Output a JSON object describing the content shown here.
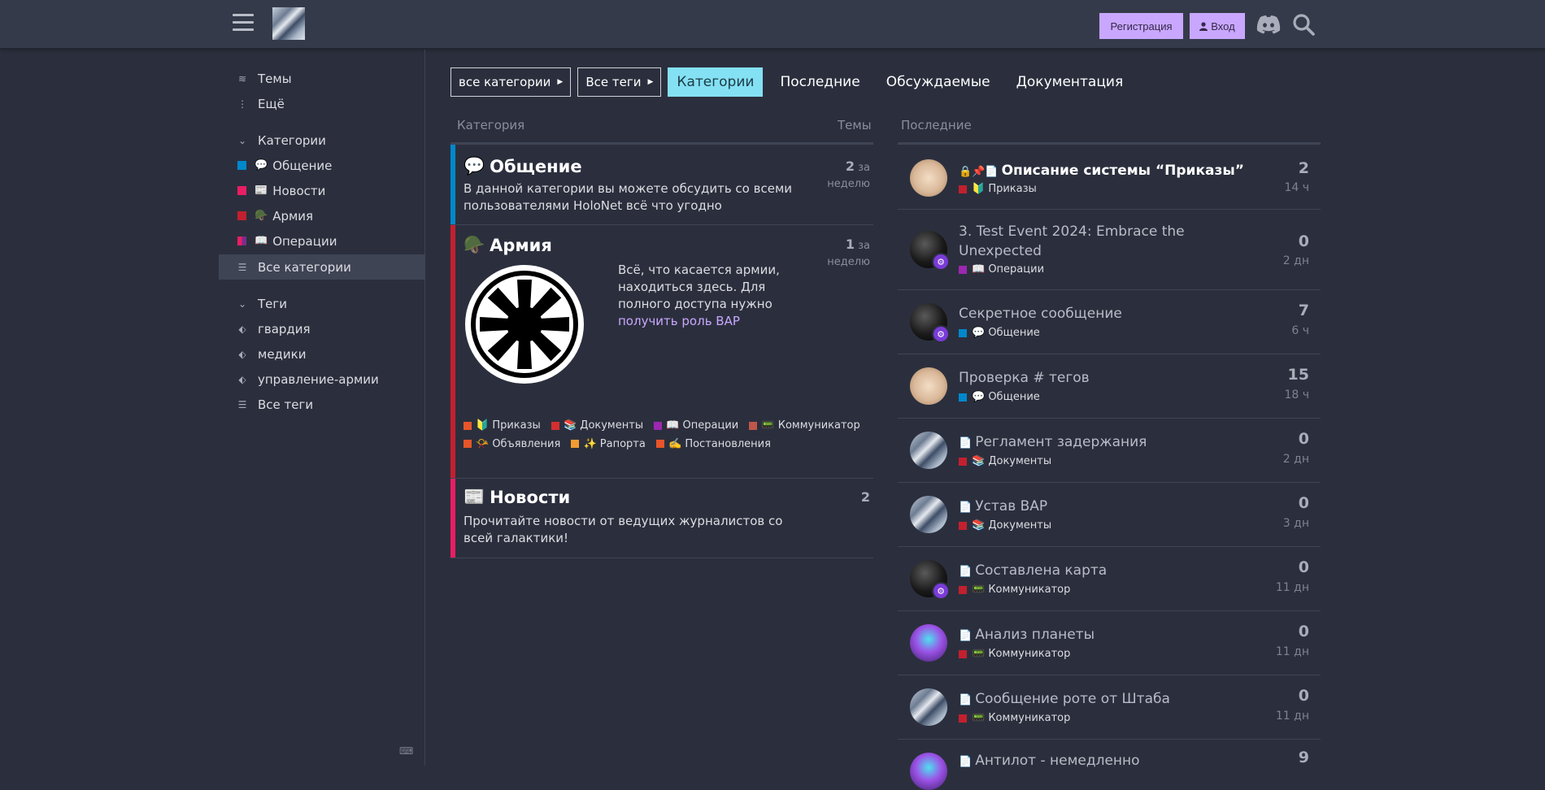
{
  "header": {
    "register_label": "Регистрация",
    "login_label": "Вход"
  },
  "sidebar": {
    "topics": "Темы",
    "more": "Ещё",
    "categories_heading": "Категории",
    "categories": [
      {
        "emoji": "💬",
        "label": "Общение",
        "color": "#0088cc"
      },
      {
        "emoji": "📰",
        "label": "Новости",
        "color": "#e91e63"
      },
      {
        "emoji": "🪖",
        "label": "Армия",
        "color": "#c3202f"
      },
      {
        "emoji": "📖",
        "label": "Операции",
        "color": "#9c27b0"
      }
    ],
    "all_categories": "Все категории",
    "tags_heading": "Теги",
    "tags": [
      "гвардия",
      "медики",
      "управление-армии"
    ],
    "all_tags": "Все теги"
  },
  "nav": {
    "all_categories": "все категории",
    "all_tags": "Все теги",
    "tabs": [
      "Категории",
      "Последние",
      "Обсуждаемые",
      "Документация"
    ]
  },
  "columns": {
    "category": "Категория",
    "topics": "Темы",
    "latest": "Последние"
  },
  "categories": [
    {
      "emoji": "💬",
      "name": "Общение",
      "color": "#0088cc",
      "description": "В данной категории вы можете обсудить со всеми пользователями HoloNet всё что угодно",
      "count": "2",
      "period": "за неделю"
    },
    {
      "emoji": "🪖",
      "name": "Армия",
      "color": "#c3202f",
      "description": "Всё, что касается армии, находиться здесь. Для полного доступа нужно",
      "link": "получить роль ВАР",
      "count": "1",
      "period": "за неделю",
      "subcategories": [
        {
          "emoji": "🔰",
          "label": "Приказы",
          "color": "#e8552a"
        },
        {
          "emoji": "📚",
          "label": "Документы",
          "color": "#d32f2f"
        },
        {
          "emoji": "📖",
          "label": "Операции",
          "color": "#9c27b0"
        },
        {
          "emoji": "📟",
          "label": "Коммуникатор",
          "color": "#c0564a"
        },
        {
          "emoji": "📯",
          "label": "Объявления",
          "color": "#e8552a"
        },
        {
          "emoji": "✨",
          "label": "Рапорта",
          "color": "#f39c32"
        },
        {
          "emoji": "✍️",
          "label": "Постановления",
          "color": "#e8552a"
        }
      ]
    },
    {
      "emoji": "📰",
      "name": "Новости",
      "color": "#e91e63",
      "description": "Прочитайте новости от ведущих журналистов со всей галактики!",
      "count": "2"
    }
  ],
  "latest": [
    {
      "title": "Описание системы “Приказы”",
      "icons": "🔒📌📄",
      "category": "Приказы",
      "cat_emoji": "🔰",
      "cat_color": "#c3202f",
      "posts": "2",
      "age": "14 ч",
      "avatar": "hands",
      "bold": true
    },
    {
      "title": "3. Test Event 2024: Embrace the Unexpected",
      "icons": "",
      "category": "Операции",
      "cat_emoji": "📖",
      "cat_color": "#9c27b0",
      "posts": "0",
      "age": "2 дн",
      "avatar": "dark",
      "badge": true
    },
    {
      "title": "Секретное сообщение",
      "icons": "",
      "category": "Общение",
      "cat_emoji": "💬",
      "cat_color": "#0088cc",
      "posts": "7",
      "age": "6 ч",
      "avatar": "dark",
      "badge": true
    },
    {
      "title": "Проверка # тегов",
      "icons": "",
      "category": "Общение",
      "cat_emoji": "💬",
      "cat_color": "#0088cc",
      "posts": "15",
      "age": "18 ч",
      "avatar": "hands"
    },
    {
      "title": "Регламент задержания",
      "icons": "📄",
      "category": "Документы",
      "cat_emoji": "📚",
      "cat_color": "#c3202f",
      "posts": "0",
      "age": "2 дн",
      "avatar": "city"
    },
    {
      "title": "Устав ВАР",
      "icons": "📄",
      "category": "Документы",
      "cat_emoji": "📚",
      "cat_color": "#c3202f",
      "posts": "0",
      "age": "3 дн",
      "avatar": "city"
    },
    {
      "title": "Составлена карта",
      "icons": "📄",
      "category": "Коммуникатор",
      "cat_emoji": "📟",
      "cat_color": "#c3202f",
      "posts": "0",
      "age": "11 дн",
      "avatar": "dark",
      "badge": true
    },
    {
      "title": "Анализ планеты",
      "icons": "📄",
      "category": "Коммуникатор",
      "cat_emoji": "📟",
      "cat_color": "#c3202f",
      "posts": "0",
      "age": "11 дн",
      "avatar": "purple"
    },
    {
      "title": "Сообщение роте от Штаба",
      "icons": "📄",
      "category": "Коммуникатор",
      "cat_emoji": "📟",
      "cat_color": "#c3202f",
      "posts": "0",
      "age": "11 дн",
      "avatar": "city"
    },
    {
      "title": "Антилот - немедленно",
      "icons": "📄",
      "category": "",
      "cat_emoji": "",
      "cat_color": "#c3202f",
      "posts": "9",
      "age": "",
      "avatar": "purple"
    }
  ]
}
